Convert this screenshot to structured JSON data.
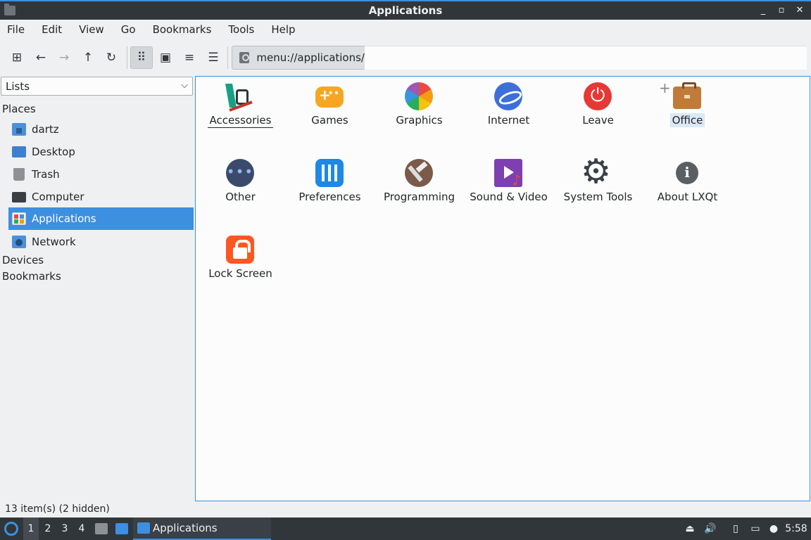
{
  "window": {
    "title": "Applications",
    "controls": [
      "_",
      "▫",
      "✕"
    ]
  },
  "menu": [
    "File",
    "Edit",
    "View",
    "Go",
    "Bookmarks",
    "Tools",
    "Help"
  ],
  "toolbar": {
    "path": "menu://applications/"
  },
  "sidebar": {
    "mode": "Lists",
    "places_heading": "Places",
    "places": [
      {
        "label": "dartz",
        "icon": "home-folder-icon"
      },
      {
        "label": "Desktop",
        "icon": "desktop-icon"
      },
      {
        "label": "Trash",
        "icon": "trash-icon"
      },
      {
        "label": "Computer",
        "icon": "computer-icon"
      },
      {
        "label": "Applications",
        "icon": "applications-icon",
        "selected": true
      },
      {
        "label": "Network",
        "icon": "network-icon"
      }
    ],
    "devices_heading": "Devices",
    "bookmarks_heading": "Bookmarks"
  },
  "items": [
    {
      "label": "Accessories",
      "icon": "accessories-icon"
    },
    {
      "label": "Games",
      "icon": "games-icon"
    },
    {
      "label": "Graphics",
      "icon": "graphics-icon"
    },
    {
      "label": "Internet",
      "icon": "internet-icon"
    },
    {
      "label": "Leave",
      "icon": "power-icon"
    },
    {
      "label": "Office",
      "icon": "briefcase-icon"
    },
    {
      "label": "Other",
      "icon": "other-icon"
    },
    {
      "label": "Preferences",
      "icon": "preferences-icon"
    },
    {
      "label": "Programming",
      "icon": "hammer-icon"
    },
    {
      "label": "Sound & Video",
      "icon": "sound-video-icon"
    },
    {
      "label": "System Tools",
      "icon": "gear-icon"
    },
    {
      "label": "About LXQt",
      "icon": "info-icon"
    },
    {
      "label": "Lock Screen",
      "icon": "lock-icon"
    }
  ],
  "status": "13 item(s) (2 hidden)",
  "taskbar": {
    "desktops": [
      "1",
      "2",
      "3",
      "4"
    ],
    "task_label": "Applications",
    "clock": "5:58"
  },
  "colors": {
    "accent": "#3d8fe0",
    "titlebar": "#31363b",
    "taskbar": "#31363b"
  }
}
